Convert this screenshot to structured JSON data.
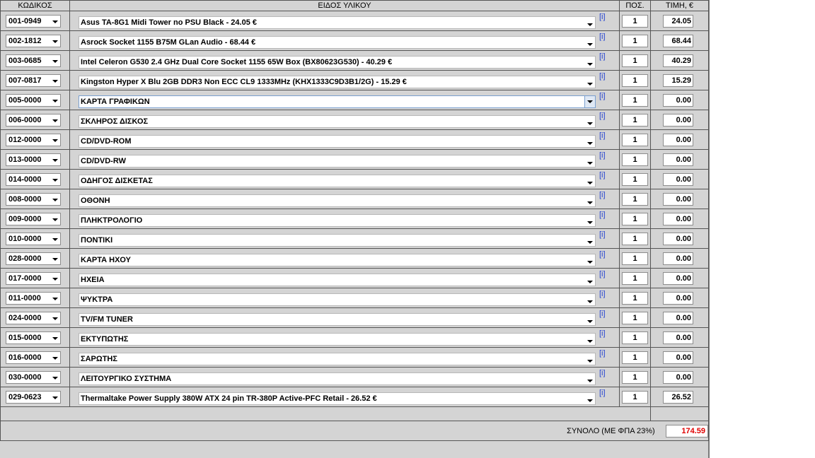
{
  "headers": {
    "code": "ΚΩΔΙΚΟΣ",
    "item": "ΕΙΔΟΣ ΥΛΙΚΟΥ",
    "qty": "ΠΟΣ.",
    "price": "ΤΙΜΗ, €"
  },
  "info_label": "[i]",
  "rows": [
    {
      "code": "001-0949",
      "item": "Asus TA-8G1 Midi Tower no PSU Black - 24.05 €",
      "qty": "1",
      "price": "24.05"
    },
    {
      "code": "002-1812",
      "item": "Asrock Socket 1155 B75M GLan Audio - 68.44 €",
      "qty": "1",
      "price": "68.44"
    },
    {
      "code": "003-0685",
      "item": "Intel Celeron G530 2.4 GHz Dual Core Socket 1155 65W Box (BX80623G530) - 40.29 €",
      "qty": "1",
      "price": "40.29"
    },
    {
      "code": "007-0817",
      "item": "Kingston Hyper X Blu 2GB DDR3 Non ECC CL9 1333MHz (KHX1333C9D3B1/2G) - 15.29 €",
      "qty": "1",
      "price": "15.29"
    },
    {
      "code": "005-0000",
      "item": "ΚΑΡΤΑ ΓΡΑΦΙΚΩΝ",
      "qty": "1",
      "price": "0.00",
      "focused": true
    },
    {
      "code": "006-0000",
      "item": "ΣΚΛΗΡΟΣ ΔΙΣΚΟΣ",
      "qty": "1",
      "price": "0.00"
    },
    {
      "code": "012-0000",
      "item": "CD/DVD-ROM",
      "qty": "1",
      "price": "0.00"
    },
    {
      "code": "013-0000",
      "item": "CD/DVD-RW",
      "qty": "1",
      "price": "0.00"
    },
    {
      "code": "014-0000",
      "item": "ΟΔΗΓΟΣ ΔΙΣΚΕΤΑΣ",
      "qty": "1",
      "price": "0.00"
    },
    {
      "code": "008-0000",
      "item": "ΟΘΟΝΗ",
      "qty": "1",
      "price": "0.00"
    },
    {
      "code": "009-0000",
      "item": "ΠΛΗΚΤΡΟΛΟΓΙΟ",
      "qty": "1",
      "price": "0.00"
    },
    {
      "code": "010-0000",
      "item": "ΠΟΝΤΙΚΙ",
      "qty": "1",
      "price": "0.00"
    },
    {
      "code": "028-0000",
      "item": "ΚΑΡΤΑ ΗΧΟΥ",
      "qty": "1",
      "price": "0.00"
    },
    {
      "code": "017-0000",
      "item": "ΗΧΕΙΑ",
      "qty": "1",
      "price": "0.00"
    },
    {
      "code": "011-0000",
      "item": "ΨΥΚΤΡΑ",
      "qty": "1",
      "price": "0.00"
    },
    {
      "code": "024-0000",
      "item": "TV/FM TUNER",
      "qty": "1",
      "price": "0.00"
    },
    {
      "code": "015-0000",
      "item": "ΕΚΤΥΠΩΤΗΣ",
      "qty": "1",
      "price": "0.00"
    },
    {
      "code": "016-0000",
      "item": "ΣΑΡΩΤΗΣ",
      "qty": "1",
      "price": "0.00"
    },
    {
      "code": "030-0000",
      "item": "ΛΕΙΤΟΥΡΓΙΚΟ ΣΥΣΤΗΜΑ",
      "qty": "1",
      "price": "0.00"
    },
    {
      "code": "029-0623",
      "item": "Thermaltake Power Supply 380W ATX 24 pin TR-380P Active-PFC Retail - 26.52 €",
      "qty": "1",
      "price": "26.52"
    }
  ],
  "total": {
    "label": "ΣΥΝΟΛΟ (ΜΕ ΦΠΑ 23%)",
    "value": "174.59"
  },
  "colors": {
    "background": "#d4d4d4",
    "total_value": "#e00000",
    "info_link": "#1f3fd0"
  }
}
